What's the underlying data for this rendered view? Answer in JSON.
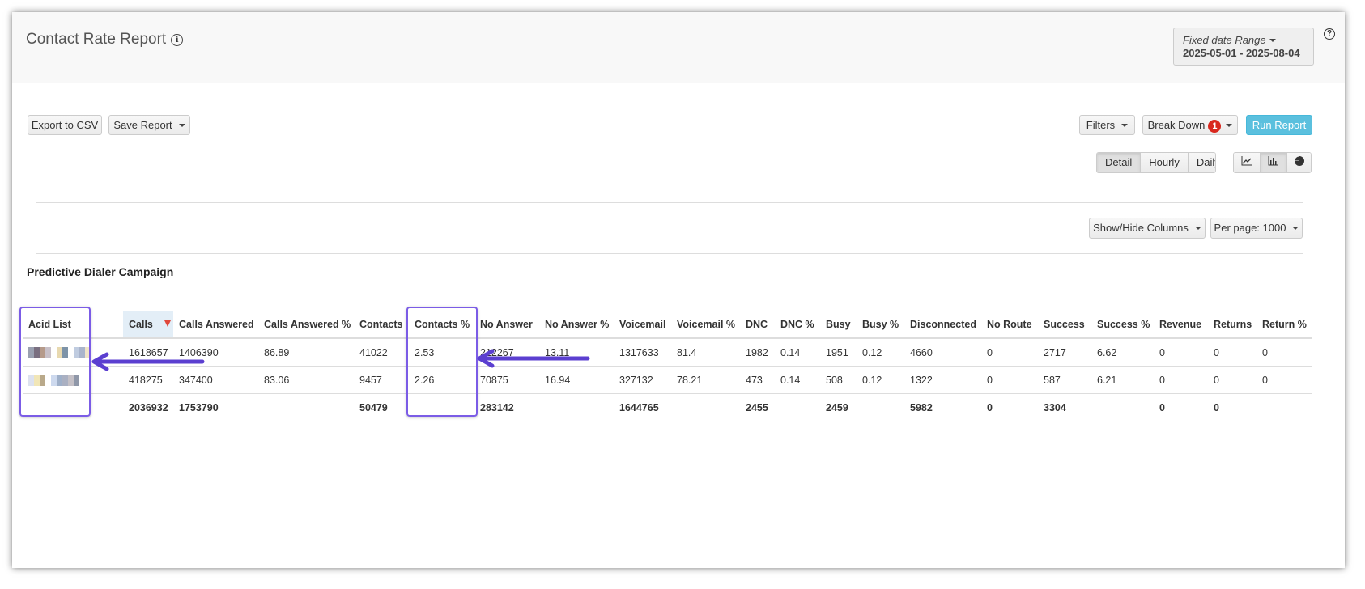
{
  "header": {
    "title": "Contact Rate Report",
    "info_icon": "info-icon",
    "help_icon": "help-icon",
    "date_range": {
      "label": "Fixed date Range",
      "value": "2025-05-01 - 2025-08-04"
    }
  },
  "toolbar": {
    "export": "Export to CSV",
    "save": "Save Report",
    "filters": "Filters",
    "breakdown": "Break Down",
    "breakdown_count": "1",
    "run": "Run Report",
    "run_color": "#5bc0de",
    "views": [
      "Detail",
      "Hourly",
      "Daily"
    ],
    "active_view": "Detail",
    "chart_icons": [
      "line-chart-icon",
      "bar-chart-icon",
      "pie-chart-icon"
    ],
    "show_hide": "Show/Hide Columns",
    "per_page": "Per page: 1000"
  },
  "section_title": "Predictive Dialer Campaign",
  "table": {
    "columns": [
      "Acid List",
      "Calls",
      "Calls Answered",
      "Calls Answered %",
      "Contacts",
      "Contacts %",
      "No Answer",
      "No Answer %",
      "Voicemail",
      "Voicemail %",
      "DNC",
      "DNC %",
      "Busy",
      "Busy %",
      "Disconnected",
      "No Route",
      "Success",
      "Success %",
      "Revenue",
      "Returns",
      "Return %"
    ],
    "sorted_column": "Calls",
    "rows": [
      [
        "",
        "1618657",
        "1406390",
        "86.89",
        "41022",
        "2.53",
        "212267",
        "13.11",
        "1317633",
        "81.4",
        "1982",
        "0.14",
        "1951",
        "0.12",
        "4660",
        "0",
        "2717",
        "6.62",
        "0",
        "0",
        "0"
      ],
      [
        "",
        "418275",
        "347400",
        "83.06",
        "9457",
        "2.26",
        "70875",
        "16.94",
        "327132",
        "78.21",
        "473",
        "0.14",
        "508",
        "0.12",
        "1322",
        "0",
        "587",
        "6.21",
        "0",
        "0",
        "0"
      ]
    ],
    "totals": [
      "",
      "2036932",
      "1753790",
      "",
      "50479",
      "",
      "283142",
      "",
      "1644765",
      "",
      "2455",
      "",
      "2459",
      "",
      "5982",
      "0",
      "3304",
      "",
      "0",
      "0",
      ""
    ]
  },
  "annotation_color": "#5b3fd0"
}
